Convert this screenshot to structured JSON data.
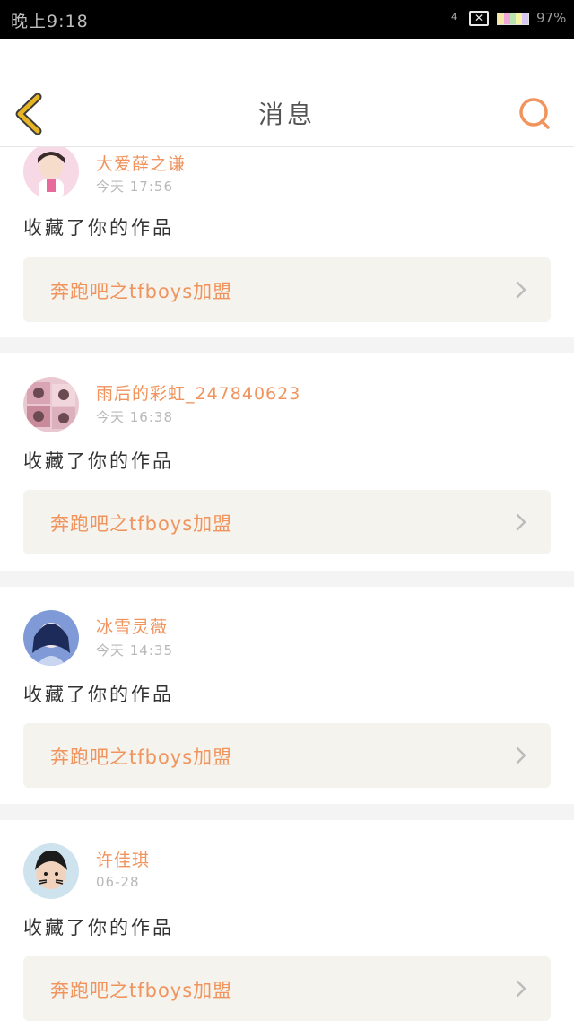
{
  "status_bar": {
    "time": "晚上9:18",
    "signal_text": "4",
    "notification_icon": "close-box-icon",
    "battery_percent": "97%",
    "battery_colors": [
      "#f3e9a9",
      "#f0a8d8",
      "#b8e4b2",
      "#f6f2a8",
      "#d7c8f2"
    ]
  },
  "nav": {
    "title": "消息",
    "back_icon": "chevron-left-icon",
    "search_icon": "search-icon",
    "back_color": "#e7b424",
    "accent_color": "#f0935c"
  },
  "messages": [
    {
      "name": "大爱薛之谦",
      "time": "今天  17:56",
      "action": "收藏了你的作品",
      "work_title": "奔跑吧之tfboys加盟",
      "avatar_colors": [
        "#f7d9e6",
        "#3a2a2a"
      ]
    },
    {
      "name": "雨后的彩虹_247840623",
      "time": "今天  16:38",
      "action": "收藏了你的作品",
      "work_title": "奔跑吧之tfboys加盟",
      "avatar_colors": [
        "#e9c8d2",
        "#6b4a52"
      ]
    },
    {
      "name": "冰雪灵薇",
      "time": "今天  14:35",
      "action": "收藏了你的作品",
      "work_title": "奔跑吧之tfboys加盟",
      "avatar_colors": [
        "#7f9ad6",
        "#1d2b5a"
      ]
    },
    {
      "name": "许佳琪",
      "time": "06-28",
      "action": "收藏了你的作品",
      "work_title": "奔跑吧之tfboys加盟",
      "avatar_colors": [
        "#cfe3ee",
        "#1b1b1b"
      ]
    }
  ],
  "colors": {
    "name": "#f0935c",
    "time": "#b8b8b8",
    "work_box": "#f4f3ee",
    "chevron": "#bdbdbd"
  }
}
